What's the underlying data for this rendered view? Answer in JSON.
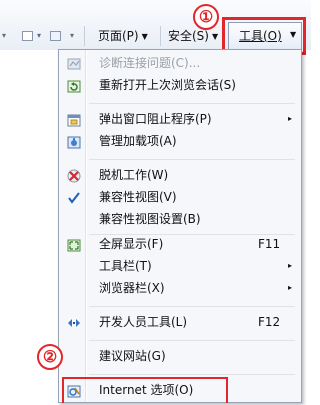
{
  "toolbar": {
    "page_label": "页面(P)",
    "safety_label": "安全(S)",
    "tools_label": "工具(O)"
  },
  "callouts": {
    "first": "①",
    "second": "②"
  },
  "menu": {
    "items": [
      {
        "label": "诊断连接问题(C)...",
        "icon": "diagnose-icon"
      },
      {
        "label": "重新打开上次浏览会话(S)",
        "icon": "reopen-session-icon"
      },
      {
        "label": "弹出窗口阻止程序(P)",
        "icon": "popup-blocker-icon",
        "submenu": "▸"
      },
      {
        "label": "管理加载项(A)",
        "icon": "manage-addons-icon"
      },
      {
        "label": "脱机工作(W)",
        "icon": "work-offline-icon"
      },
      {
        "label": "兼容性视图(V)",
        "icon": "checkmark-icon"
      },
      {
        "label": "兼容性视图设置(B)"
      },
      {
        "label": "全屏显示(F)",
        "icon": "fullscreen-icon",
        "shortcut": "F11"
      },
      {
        "label": "工具栏(T)",
        "submenu": "▸"
      },
      {
        "label": "浏览器栏(X)",
        "submenu": "▸"
      },
      {
        "label": "开发人员工具(L)",
        "icon": "developer-tools-icon",
        "shortcut": "F12"
      },
      {
        "label": "建议网站(G)"
      },
      {
        "label": "Internet 选项(O)",
        "icon": "internet-options-icon"
      }
    ]
  },
  "colors": {
    "accent_red": "#e3262a",
    "menu_bg": "#f5f7fb",
    "check_blue": "#1f5fb8"
  }
}
